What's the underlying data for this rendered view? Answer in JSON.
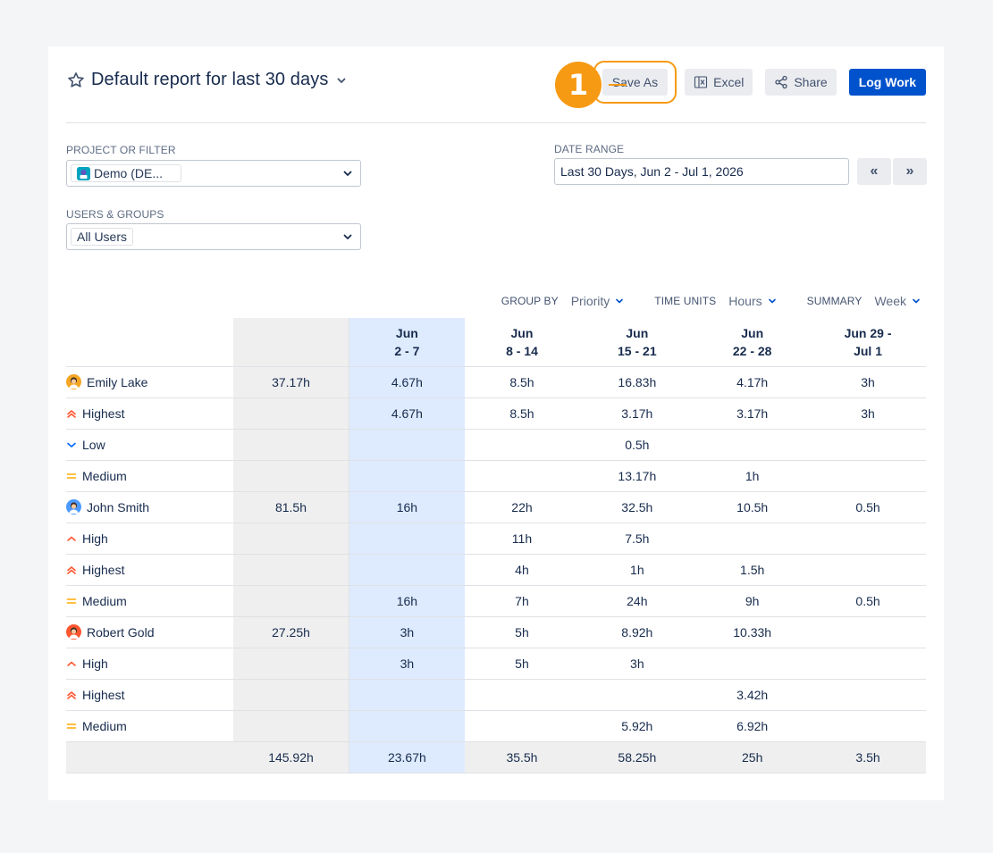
{
  "report": {
    "title": "Default report for last 30 days",
    "callout_number": "1"
  },
  "actions": {
    "save_as": "Save As",
    "excel": "Excel",
    "share": "Share",
    "log_work": "Log Work"
  },
  "filters": {
    "project_label": "PROJECT OR FILTER",
    "project_value": "Demo (DE...",
    "date_label": "DATE RANGE",
    "date_value": "Last 30 Days, Jun 2 - Jul 1, 2026",
    "prev_label": "«",
    "next_label": "»",
    "users_label": "USERS & GROUPS",
    "users_value": "All Users"
  },
  "controls": {
    "group_by_label": "GROUP BY",
    "group_by_value": "Priority",
    "time_units_label": "TIME UNITS",
    "time_units_value": "Hours",
    "summary_label": "SUMMARY",
    "summary_value": "Week"
  },
  "table": {
    "headers": [
      {
        "line1": "Jun",
        "line2": "2 - 7"
      },
      {
        "line1": "Jun",
        "line2": "8 - 14"
      },
      {
        "line1": "Jun",
        "line2": "15 - 21"
      },
      {
        "line1": "Jun",
        "line2": "22 - 28"
      },
      {
        "line1": "Jun 29 -",
        "line2": "Jul 1"
      }
    ],
    "rows": [
      {
        "type": "user",
        "name": "Emily Lake",
        "avatar_color": "#F5A623",
        "total": "37.17h",
        "weeks": [
          "4.67h",
          "8.5h",
          "16.83h",
          "4.17h",
          "3h"
        ]
      },
      {
        "type": "priority",
        "priority": "highest",
        "name": "Highest",
        "total": "",
        "weeks": [
          "4.67h",
          "8.5h",
          "3.17h",
          "3.17h",
          "3h"
        ]
      },
      {
        "type": "priority",
        "priority": "low",
        "name": "Low",
        "total": "",
        "weeks": [
          "",
          "",
          "0.5h",
          "",
          ""
        ]
      },
      {
        "type": "priority",
        "priority": "medium",
        "name": "Medium",
        "total": "",
        "weeks": [
          "",
          "",
          "13.17h",
          "1h",
          ""
        ]
      },
      {
        "type": "user",
        "name": "John Smith",
        "avatar_color": "#4C9AFF",
        "total": "81.5h",
        "weeks": [
          "16h",
          "22h",
          "32.5h",
          "10.5h",
          "0.5h"
        ]
      },
      {
        "type": "priority",
        "priority": "high",
        "name": "High",
        "total": "",
        "weeks": [
          "",
          "11h",
          "7.5h",
          "",
          ""
        ]
      },
      {
        "type": "priority",
        "priority": "highest",
        "name": "Highest",
        "total": "",
        "weeks": [
          "",
          "4h",
          "1h",
          "1.5h",
          ""
        ]
      },
      {
        "type": "priority",
        "priority": "medium",
        "name": "Medium",
        "total": "",
        "weeks": [
          "16h",
          "7h",
          "24h",
          "9h",
          "0.5h"
        ]
      },
      {
        "type": "user",
        "name": "Robert Gold",
        "avatar_color": "#FF5630",
        "total": "27.25h",
        "weeks": [
          "3h",
          "5h",
          "8.92h",
          "10.33h",
          ""
        ]
      },
      {
        "type": "priority",
        "priority": "high",
        "name": "High",
        "total": "",
        "weeks": [
          "3h",
          "5h",
          "3h",
          "",
          ""
        ]
      },
      {
        "type": "priority",
        "priority": "highest",
        "name": "Highest",
        "total": "",
        "weeks": [
          "",
          "",
          "",
          "3.42h",
          ""
        ]
      },
      {
        "type": "priority",
        "priority": "medium",
        "name": "Medium",
        "total": "",
        "weeks": [
          "",
          "",
          "5.92h",
          "6.92h",
          ""
        ]
      }
    ],
    "footer": {
      "total": "145.92h",
      "weeks": [
        "23.67h",
        "35.5h",
        "58.25h",
        "25h",
        "3.5h"
      ]
    }
  },
  "colors": {
    "primary": "#0052CC",
    "callout": "#F79A13",
    "highlight_column": "#DEEBFF",
    "total_column": "#EFEFEF",
    "priority_high": "#FF5630",
    "priority_low": "#0065FF",
    "priority_medium": "#FFAB00"
  }
}
